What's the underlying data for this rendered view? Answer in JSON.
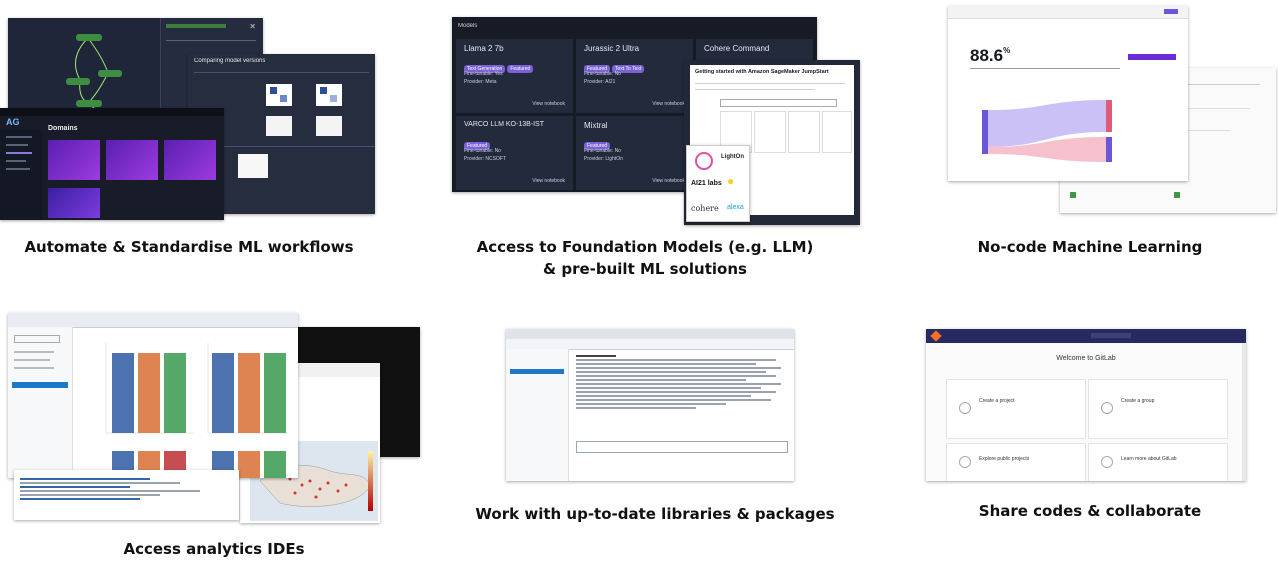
{
  "captions": {
    "c1": "Automate & Standardise ML workflows",
    "c2a": "Access to Foundation Models (e.g. LLM)",
    "c2b": "& pre-built ML solutions",
    "c3": "No-code Machine Learning",
    "c4": "Access analytics IDEs",
    "c5": "Work with up-to-date libraries & packages",
    "c6": "Share codes & collaborate"
  },
  "tile1": {
    "panel_title": "Comparing model versions",
    "app_logo": "AG",
    "domains_title": "Domains"
  },
  "tile2": {
    "header": "Models",
    "cards": [
      {
        "title": "Llama 2 7b",
        "tags": [
          "Text Generation",
          "Featured"
        ],
        "lines": [
          "Fine-tunable: Yes",
          "Provider: Meta"
        ],
        "link": "View notebook"
      },
      {
        "title": "Jurassic 2 Ultra",
        "tags": [
          "Featured",
          "Text To Text"
        ],
        "lines": [
          "Fine-tunable: No",
          "Provider: AI21"
        ],
        "link": "View notebook"
      },
      {
        "title": "Cohere Command",
        "tags": [],
        "lines": [],
        "link": ""
      },
      {
        "title": "VARCO LLM KO-13B-IST",
        "tags": [
          "Featured"
        ],
        "lines": [
          "Fine-tunable: No",
          "Provider: NCSOFT"
        ],
        "link": "View notebook"
      },
      {
        "title": "Mixtral",
        "tags": [
          "Featured"
        ],
        "lines": [
          "Fine-tunable: No",
          "Provider: LightOn"
        ],
        "link": "View notebook"
      }
    ],
    "popup_title": "Getting started with Amazon SageMaker JumpStart",
    "logos": [
      "LightOn",
      "AI21 labs",
      "cohere",
      "alexa"
    ]
  },
  "tile3": {
    "metric": "88.6",
    "metric_unit": "%"
  },
  "tile6": {
    "welcome": "Welcome to GitLab",
    "actions": [
      "Create a project",
      "Create a group",
      "Explore public projects",
      "Learn more about GitLab"
    ]
  },
  "colors": {
    "bar_blue": "#4c72b0",
    "bar_orange": "#dd8452",
    "bar_green": "#55a868",
    "bar_red": "#c44e52",
    "purple": "#6b2bd9"
  }
}
